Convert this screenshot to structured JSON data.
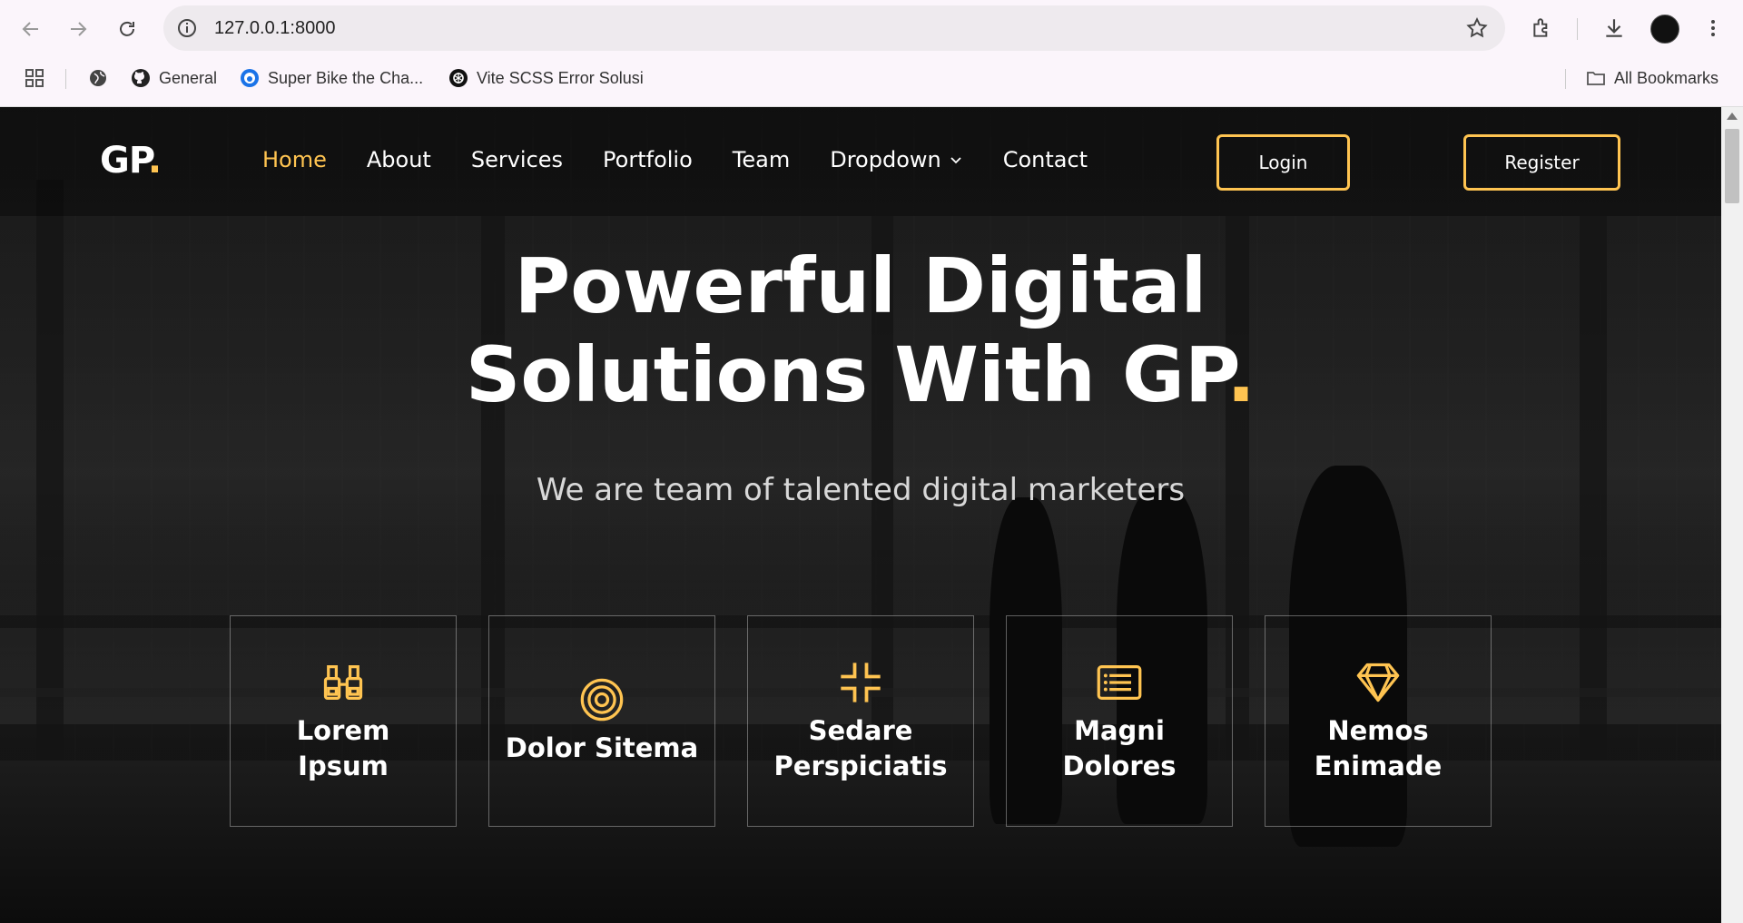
{
  "browser": {
    "url": "127.0.0.1:8000",
    "bookmarks": [
      {
        "label": "General",
        "icon": "github-icon"
      },
      {
        "label": "Super Bike the Cha...",
        "icon": "site-icon"
      },
      {
        "label": "Vite SCSS Error Solusi",
        "icon": "openai-icon"
      }
    ],
    "all_bookmarks": "All Bookmarks"
  },
  "header": {
    "logo_text": "GP",
    "logo_dot": ".",
    "nav": [
      "Home",
      "About",
      "Services",
      "Portfolio",
      "Team",
      "Dropdown",
      "Contact"
    ],
    "active_nav": "Home",
    "login": "Login",
    "register": "Register"
  },
  "hero": {
    "title_line1": "Powerful Digital",
    "title_line2": "Solutions With GP",
    "title_dot": ".",
    "subtitle": "We are team of talented digital marketers"
  },
  "features": [
    {
      "title_line1": "Lorem",
      "title_line2": "Ipsum",
      "icon": "binoculars-icon"
    },
    {
      "title_line1": "Dolor Sitema",
      "title_line2": "",
      "icon": "target-icon"
    },
    {
      "title_line1": "Sedare",
      "title_line2": "Perspiciatis",
      "icon": "minimize-icon"
    },
    {
      "title_line1": "Magni",
      "title_line2": "Dolores",
      "icon": "list-card-icon"
    },
    {
      "title_line1": "Nemos",
      "title_line2": "Enimade",
      "icon": "gem-icon"
    }
  ],
  "colors": {
    "accent": "#ffc451"
  }
}
